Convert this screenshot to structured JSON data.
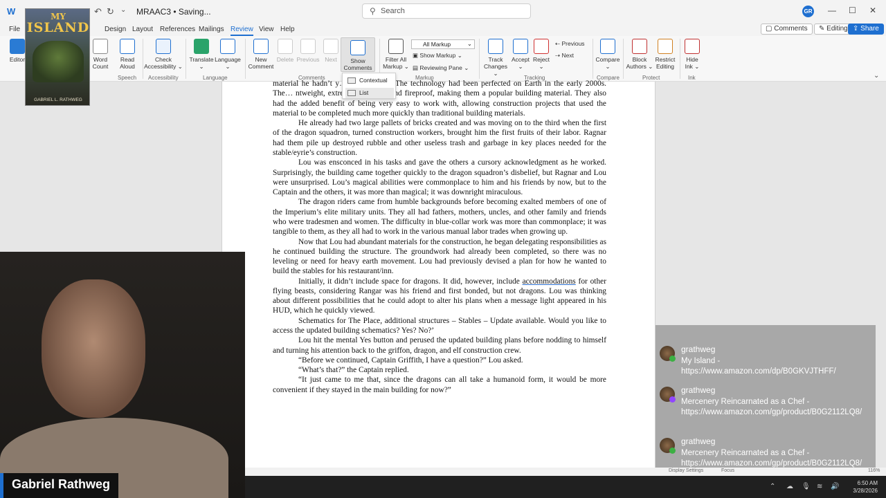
{
  "titlebar": {
    "doc_title": "MRAAC3 • Saving...",
    "search_placeholder": "Search",
    "avatar_initials": "GR",
    "minimize": "—",
    "maximize": "☐",
    "close": "✕"
  },
  "menu": {
    "tabs": [
      "File",
      "Design",
      "Layout",
      "References",
      "Mailings",
      "Review",
      "View",
      "Help"
    ],
    "comments_btn": "Comments",
    "editing_btn": "Editing",
    "share_btn": "Share"
  },
  "ribbon": {
    "editor": "Editor",
    "word_count": [
      "Word",
      "Count"
    ],
    "read_aloud": [
      "Read",
      "Aloud"
    ],
    "check_accessibility": [
      "Check",
      "Accessibility"
    ],
    "translate": "Translate",
    "language": "Language",
    "new_comment": [
      "New",
      "Comment"
    ],
    "delete": "Delete",
    "previous_comment": "Previous",
    "next_comment": "Next",
    "show_comments": [
      "Show",
      "Comments"
    ],
    "filter_all_markup": [
      "Filter All",
      "Markup"
    ],
    "all_markup": "All Markup",
    "show_markup": "Show Markup",
    "reviewing_pane": "Reviewing Pane",
    "track_changes": [
      "Track",
      "Changes"
    ],
    "accept": "Accept",
    "reject": "Reject",
    "previous": "Previous",
    "next": "Next",
    "compare": "Compare",
    "block_authors": [
      "Block",
      "Authors"
    ],
    "restrict_editing": [
      "Restrict",
      "Editing"
    ],
    "hide_ink": [
      "Hide",
      "Ink"
    ],
    "groups": {
      "speech": "Speech",
      "accessibility": "Accessibility",
      "language": "Language",
      "comments": "Comments",
      "markup": "Markup",
      "tracking": "Tracking",
      "compare": "Compare",
      "protect": "Protect",
      "ink": "Ink"
    }
  },
  "dropdown": {
    "items": [
      "Contextual",
      "List"
    ]
  },
  "document": {
    "paragraphs": [
      "material he hadn’t y… orld of Soul. The technology had been perfected on Earth in the early 2000s. The… ntweight, extremely durable, and fireproof, making them a popular building material. They also had the added benefit of being very easy to work with, allowing construction projects that used the material to be completed much more quickly than traditional building materials.",
      "He already had two large pallets of bricks created and was moving on to the third when the first of the dragon squadron, turned construction workers, brought him the first fruits of their labor. Ragnar had them pile up destroyed rubble and other useless trash and garbage in key places needed for the stable/eyrie’s construction.",
      "Lou was ensconced in his tasks and gave the others a cursory acknowledgment as he worked. Surprisingly, the building came together quickly to the dragon squadron’s disbelief, but Ragnar and Lou were unsurprised. Lou’s magical abilities were commonplace to him and his friends by now, but to the Captain and the others, it was more than magical; it was downright miraculous.",
      "The dragon riders came from humble backgrounds before becoming exalted members of one of the Imperium’s elite military units. They all had fathers, mothers, uncles, and other family and friends who were tradesmen and women. The difficulty in blue-collar work was more than commonplace; it was tangible to them, as they all had to work in the various manual labor trades when growing up.",
      "Now that Lou had abundant materials for the construction, he began delegating responsibilities as he continued building the structure. The groundwork had already been completed, so there was no leveling or need for heavy earth movement. Lou had previously devised a plan for how he wanted to build the stables for his restaurant/inn."
    ],
    "p6_before": "Initially, it didn’t include space for dragons. It did, however, include ",
    "p6_underlined": "accommodations",
    "p6_after": " for other flying beasts, considering Rangar was his friend and first bonded, but not dragons. Lou was thinking about different possibilities that he could adopt to alter his plans when a message light appeared in his HUD, which he quickly viewed.",
    "paragraphs_end": [
      "Schematics for The Place, additional structures – Stables – Update available. Would you like to access the updated building schematics? Yes? No?’",
      "Lou hit the mental Yes button and perused the updated building plans before nodding to himself and turning his attention back to the griffon, dragon, and elf construction crew.",
      "“Before we continued, Captain Griffith, I have a question?” Lou asked.",
      "“What’s that?” the Captain replied.",
      "“It just came to me that, since the dragons can all take a humanoid form, it would be more convenient if they stayed in the main building for now?”"
    ]
  },
  "book_cover": {
    "line1": "MY",
    "line2": "ISLAND",
    "author": "GABRIEL L. RATHWEG"
  },
  "streamer": {
    "name": "Gabriel Rathweg"
  },
  "chat": {
    "messages": [
      {
        "user": "grathweg",
        "text": "My Island - https://www.amazon.com/dp/B0GKVJTHFF/",
        "badge_color": "#3cb043"
      },
      {
        "user": "grathweg",
        "text": "Mercenery Reincarnated as a Chef - https://www.amazon.com/gp/product/B0G2112LQ8/",
        "badge_color": "#9146ff"
      },
      {
        "user": "grathweg",
        "text": "Mercenery Reincarnated as a Chef - https://www.amazon.com/gp/product/B0G2112LQ8/",
        "badge_color": "#3cb043"
      }
    ]
  },
  "statusbar": {
    "display_settings": "Display Settings",
    "focus": "Focus",
    "zoom": "116%"
  },
  "taskbar": {
    "time": "6:50 AM",
    "date": "3/28/2026"
  }
}
